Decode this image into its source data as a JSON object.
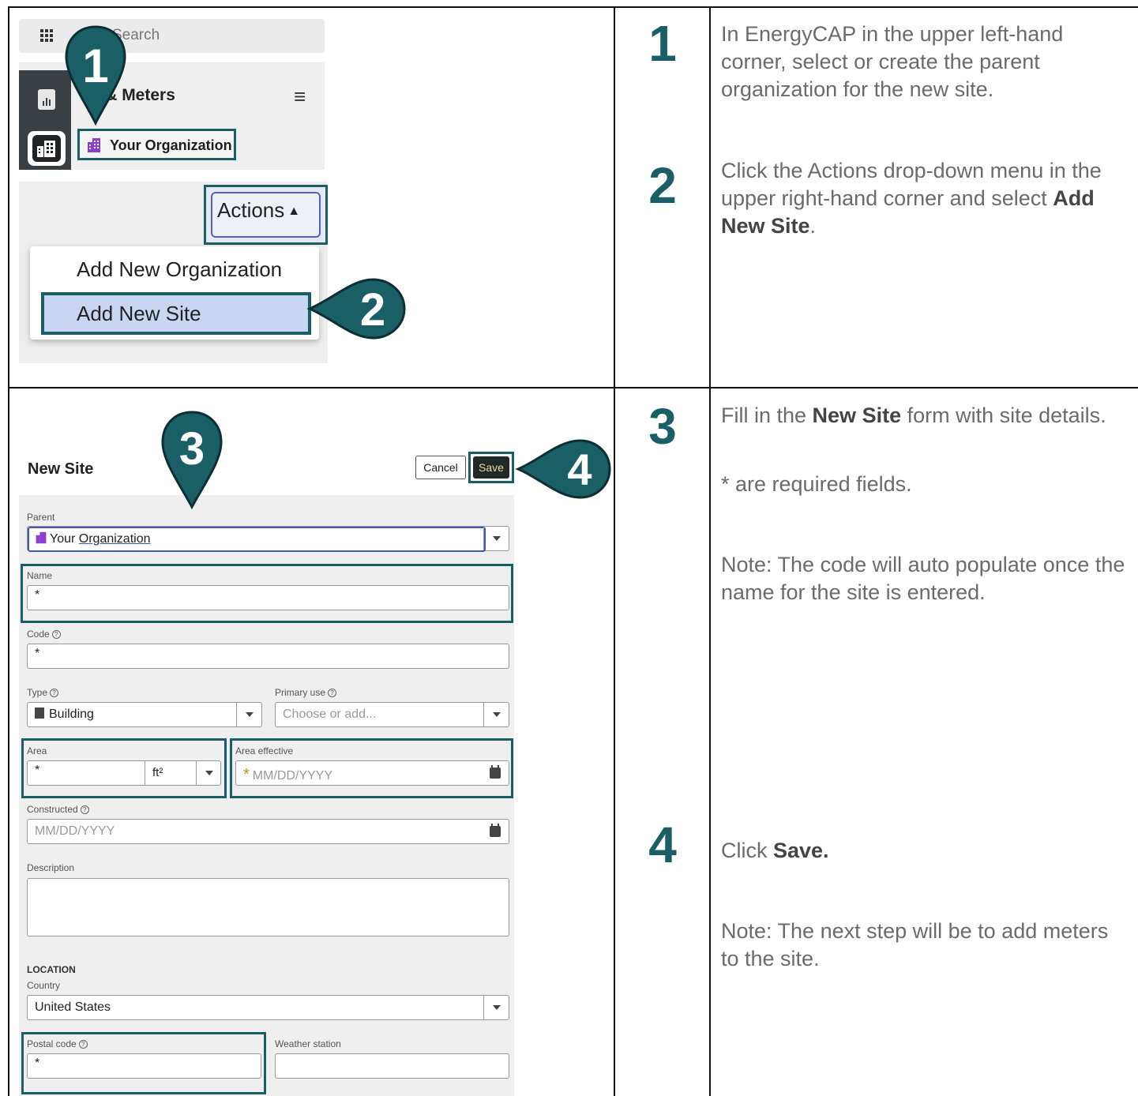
{
  "steps": [
    {
      "number": "1",
      "text": "In EnergyCAP in the upper left-hand corner, select or create the parent organization for the new site."
    },
    {
      "number": "2",
      "text_pre": "Click the Actions drop-down menu in the upper right-hand corner and select ",
      "text_bold": "Add New Site",
      "text_post": "."
    },
    {
      "number": "3",
      "text_pre": "Fill in the ",
      "text_bold": "New Site",
      "text_post": " form with site details.",
      "required_note": "* are required fields.",
      "note": "Note: The code will auto populate once the name for the site is entered."
    },
    {
      "number": "4",
      "text_pre": "Click ",
      "text_bold": "Save.",
      "note": "Note: The next step will be to add meters to the site."
    }
  ],
  "markers": [
    "1",
    "2",
    "3",
    "4"
  ],
  "shot1": {
    "search_placeholder": "Search",
    "nav_title": "es & Meters",
    "org_label": "Your Organization",
    "actions_label": "Actions",
    "menu": [
      "Add New Organization",
      "Add New Site"
    ]
  },
  "form": {
    "title": "New Site",
    "cancel": "Cancel",
    "save": "Save",
    "parent_label": "Parent",
    "parent_value_a": "Your ",
    "parent_value_b": "Organization",
    "name_label": "Name",
    "code_label": "Code",
    "type_label": "Type",
    "type_value": "Building",
    "primary_use_label": "Primary use",
    "primary_use_placeholder": "Choose or add...",
    "area_label": "Area",
    "area_unit": "ft²",
    "area_effective_label": "Area effective",
    "date_placeholder": "MM/DD/YYYY",
    "constructed_label": "Constructed",
    "description_label": "Description",
    "location_section": "LOCATION",
    "country_label": "Country",
    "country_value": "United States",
    "postal_label": "Postal code",
    "weather_label": "Weather station",
    "required_mark": "*"
  },
  "colors": {
    "accent": "#1a5f66",
    "step_number": "#1a5f66",
    "required": "#c58d12"
  },
  "icons": [
    "grid-icon",
    "report-icon",
    "buildings-icon",
    "organization-icon",
    "hamburger-icon",
    "caret-up-icon",
    "chevron-down-icon",
    "calendar-icon",
    "help-icon",
    "building-icon"
  ]
}
